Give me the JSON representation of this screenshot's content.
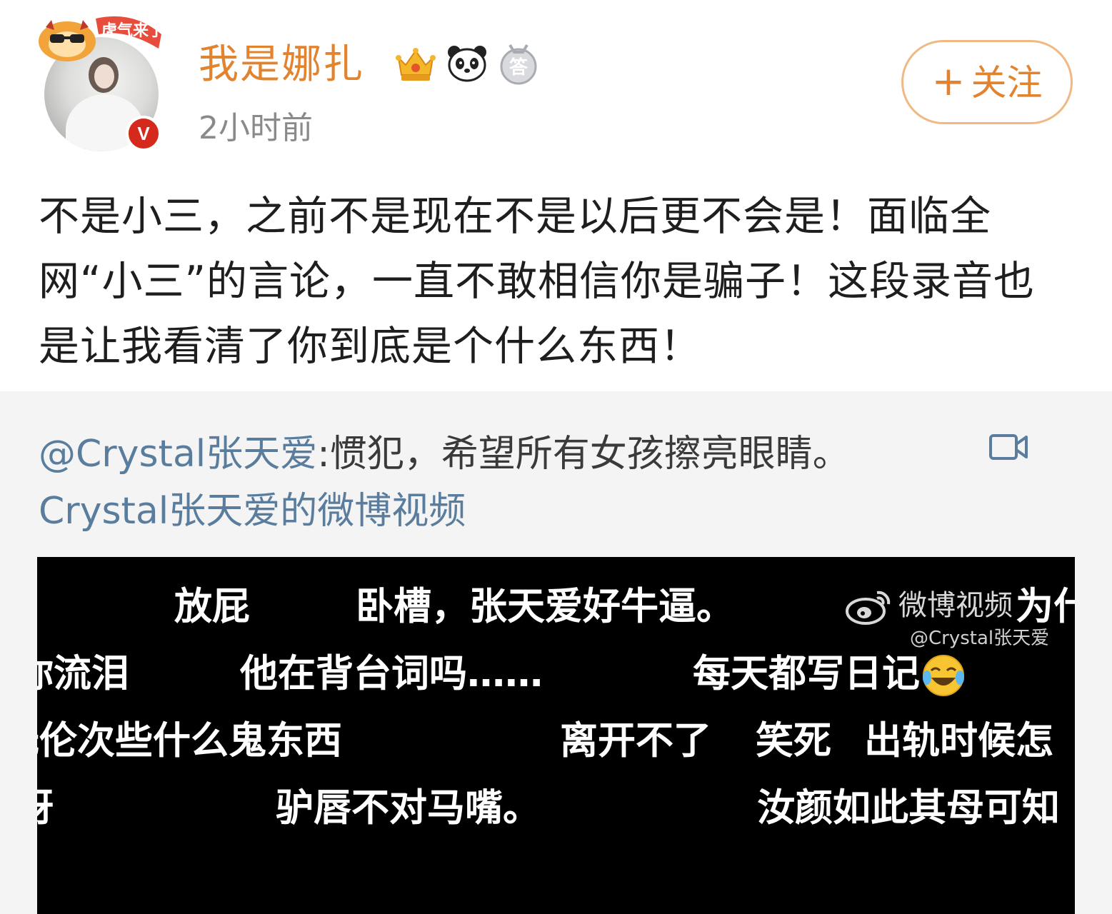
{
  "post": {
    "username": "我是娜扎",
    "timestamp": "2小时前",
    "follow_plus": "+",
    "follow_label": "关注",
    "verified_mark": "V",
    "avatar_pendant_text": "虎气来了",
    "badges": [
      "crown-badge-icon",
      "panda-badge-icon",
      "answer-badge-icon"
    ],
    "badge_answer_char": "答",
    "text": "不是小三，之前不是现在不是以后更不会是！面临全网“小三”的言论，一直不敢相信你是骗子！这段录音也是让我看清了你到底是个什么东西！"
  },
  "repost": {
    "mention": "@Crystal张天爱",
    "text": ":惯犯，希望所有女孩擦亮眼睛。",
    "video_link": "Crystal张天爱的微博视频",
    "video_icon": "video-camera-icon"
  },
  "video": {
    "watermark_title": "微博视频",
    "watermark_user": "@Crystal张天爱",
    "danmaku": [
      "放屁",
      "卧槽，张天爱好牛逼。",
      "为什",
      "你流泪",
      "他在背台词吗……",
      "每天都写日记",
      "无伦次些什么鬼东西",
      "离开不了",
      "笑死",
      "出轨时候怎",
      "呀",
      "驴唇不对马嘴。",
      "汝颜如此其母可知"
    ],
    "emoji": "laugh-cry-emoji-icon"
  },
  "colors": {
    "username": "#e2842f",
    "follow_border": "#f0b983",
    "link": "#5a7d9e",
    "repost_bg": "#f4f4f5",
    "video_bg": "#000000"
  }
}
